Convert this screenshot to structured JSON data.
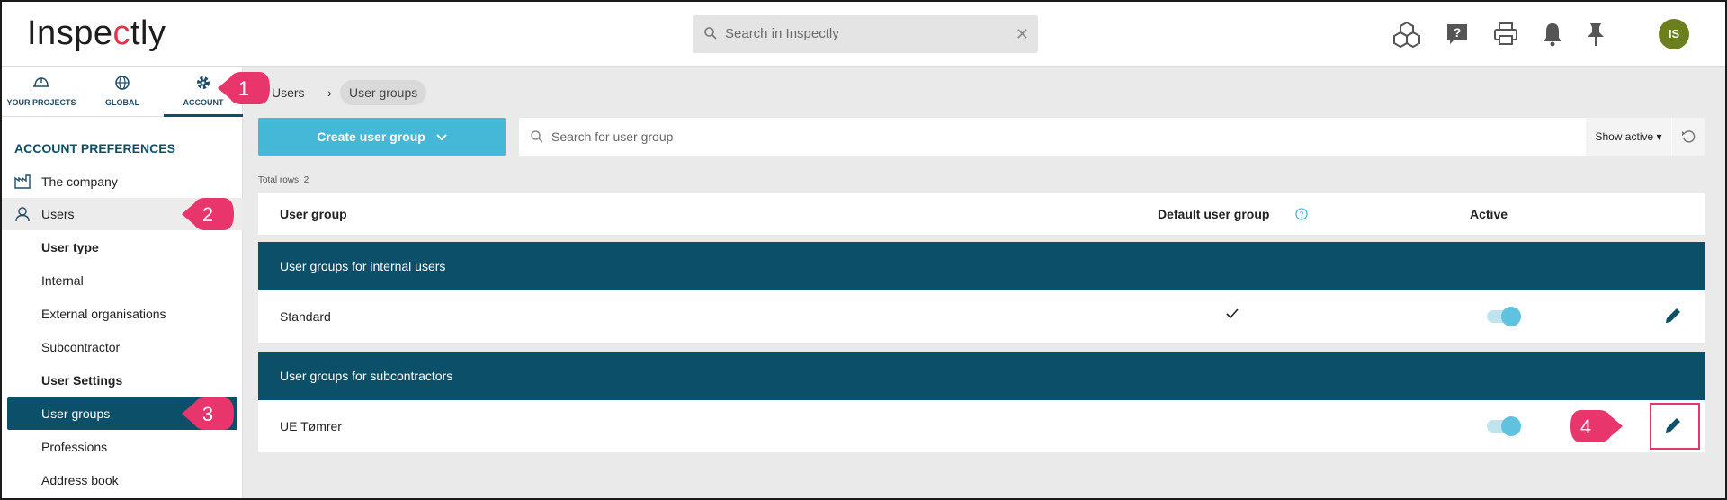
{
  "header": {
    "logo_pre": "Inspe",
    "logo_c": "c",
    "logo_post": "tly",
    "search_placeholder": "Search in Inspectly",
    "avatar_initials": "IS"
  },
  "sidebar": {
    "tabs": [
      {
        "label": "YOUR PROJECTS",
        "icon": "helmet-icon"
      },
      {
        "label": "GLOBAL",
        "icon": "globe-icon"
      },
      {
        "label": "ACCOUNT",
        "icon": "gear-icon"
      }
    ],
    "section_title": "ACCOUNT PREFERENCES",
    "items": [
      {
        "label": "The company"
      },
      {
        "label": "Users"
      },
      {
        "label": "User type"
      },
      {
        "label": "Internal"
      },
      {
        "label": "External organisations"
      },
      {
        "label": "Subcontractor"
      },
      {
        "label": "User Settings"
      },
      {
        "label": "User groups"
      },
      {
        "label": "Professions"
      },
      {
        "label": "Address book"
      }
    ]
  },
  "main": {
    "breadcrumb": {
      "parent": "Users",
      "current": "User groups"
    },
    "create_label": "Create user group",
    "search_placeholder": "Search for user group",
    "show_active_label": "Show active",
    "total_rows": "Total rows: 2",
    "columns": {
      "group": "User group",
      "default": "Default user group",
      "active": "Active"
    },
    "groups": [
      {
        "title": "User groups for internal users",
        "rows": [
          {
            "name": "Standard",
            "default": true,
            "active": true
          }
        ]
      },
      {
        "title": "User groups for subcontractors",
        "rows": [
          {
            "name": "UE Tømrer",
            "default": false,
            "active": true
          }
        ]
      }
    ]
  },
  "callouts": [
    "1",
    "2",
    "3",
    "4"
  ],
  "colors": {
    "primary": "#0b5068",
    "accent": "#45b8d7",
    "callout": "#e8356c",
    "avatar": "#6c7f1f"
  }
}
